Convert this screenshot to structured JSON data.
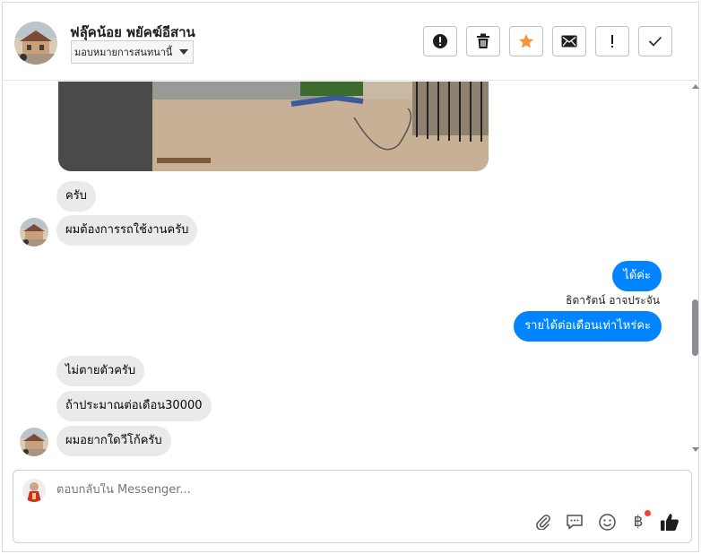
{
  "header": {
    "contact_name": "ฟลุ๊คน้อย พยัคฆ์อีสาน",
    "assign_label": "มอบหมายการสนทนานี้",
    "toolbar": [
      {
        "name": "spam-button",
        "icon": "alert-circle-icon"
      },
      {
        "name": "delete-button",
        "icon": "trash-icon"
      },
      {
        "name": "star-button",
        "icon": "star-icon"
      },
      {
        "name": "mark-unread-button",
        "icon": "envelope-icon"
      },
      {
        "name": "follow-up-button",
        "icon": "exclamation-icon"
      },
      {
        "name": "mark-done-button",
        "icon": "check-icon"
      }
    ]
  },
  "messages": {
    "in_1": "ครับ",
    "in_2": "ผมต้องการรถใช้งานครับ",
    "out_1": "ได้ค่ะ",
    "sender_name": "ธิดารัตน์ อาจประจัน",
    "out_2": "รายได้ต่อเดือนเท่าไหร่คะ",
    "in_3": "ไม่ตายตัวครับ",
    "in_4": "ถ้าประมาณต่อเดือน30000",
    "in_5": "ผมอยากใดวีโก้ครับ"
  },
  "composer": {
    "placeholder": "ตอบกลับใน Messenger...",
    "currency_symbol": "฿",
    "icons": [
      "attach-icon",
      "saved-reply-icon",
      "emoji-icon",
      "payment-icon",
      "like-icon"
    ]
  },
  "colors": {
    "accent": "#0084ff",
    "incoming_bubble": "#e9eaeb",
    "star": "#f7923b",
    "notification_dot": "#fa3e3e"
  }
}
